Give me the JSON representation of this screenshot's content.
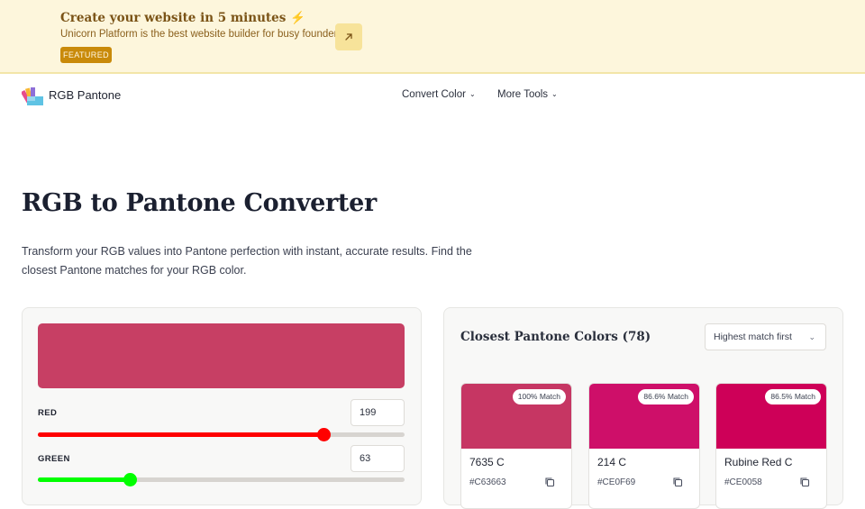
{
  "banner": {
    "title": "Create your website in 5 minutes ⚡",
    "subtitle": "Unicorn Platform is the best website builder for busy founders.",
    "badge": "FEATURED",
    "link_icon": "arrow-up-right-icon"
  },
  "nav": {
    "brand": "RGB Pantone",
    "items": [
      {
        "label": "Convert Color"
      },
      {
        "label": "More Tools"
      }
    ]
  },
  "hero": {
    "title": "RGB to Pantone Converter",
    "description": "Transform your RGB values into Pantone perfection with instant, accurate results. Find the closest Pantone matches for your RGB color."
  },
  "picker": {
    "preview_color": "#C73F64",
    "channels": [
      {
        "label": "RED",
        "value": "199",
        "fraction": 0.78,
        "color": "#ff0000"
      },
      {
        "label": "GREEN",
        "value": "63",
        "fraction": 0.25,
        "color": "#00ff00"
      }
    ]
  },
  "results": {
    "title": "Closest Pantone Colors (78)",
    "sort": "Highest match first",
    "swatches": [
      {
        "match": "100% Match",
        "name": "7635 C",
        "hex": "#C63663",
        "color": "#C63663"
      },
      {
        "match": "86.6% Match",
        "name": "214 C",
        "hex": "#CE0F69",
        "color": "#CE0F69"
      },
      {
        "match": "86.5% Match",
        "name": "Rubine Red C",
        "hex": "#CE0058",
        "color": "#CE0058"
      }
    ]
  }
}
